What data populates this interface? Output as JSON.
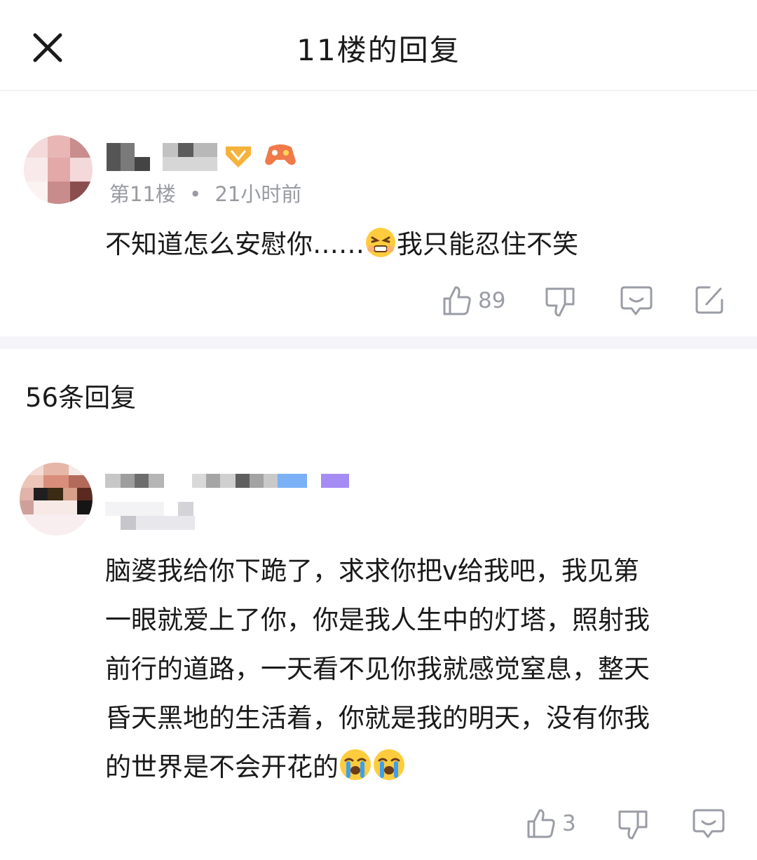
{
  "header": {
    "title": "11楼的回复",
    "close_icon": "close-icon"
  },
  "main_post": {
    "floor": "第11楼",
    "separator": "•",
    "time": "21小时前",
    "text_before": "不知道怎么安慰你……",
    "text_after": "我只能忍住不笑",
    "emoji": "strained-face-emoji",
    "likes": "89",
    "actions": [
      "like-icon",
      "dislike-icon",
      "comment-icon",
      "edit-icon"
    ]
  },
  "replies_header": {
    "count_label": "56条回复"
  },
  "reply": {
    "lines": [
      "脑婆我给你下跪了，求求你把v给我吧，我见第",
      "一眼就爱上了你，你是我人生中的灯塔，照射我",
      "前行的道路，一天看不见你我就感觉窒息，整天",
      "昏天黑地的生活着，你就是我的明天，没有你我"
    ],
    "last_line": "的世界是不会开花的",
    "emoji": "loudly-crying-face-emoji",
    "likes": "3"
  },
  "colors": {
    "accent_blue": "#7ab0f5",
    "accent_purple": "#a58cf5",
    "icon_gray": "#9a9ca6"
  }
}
